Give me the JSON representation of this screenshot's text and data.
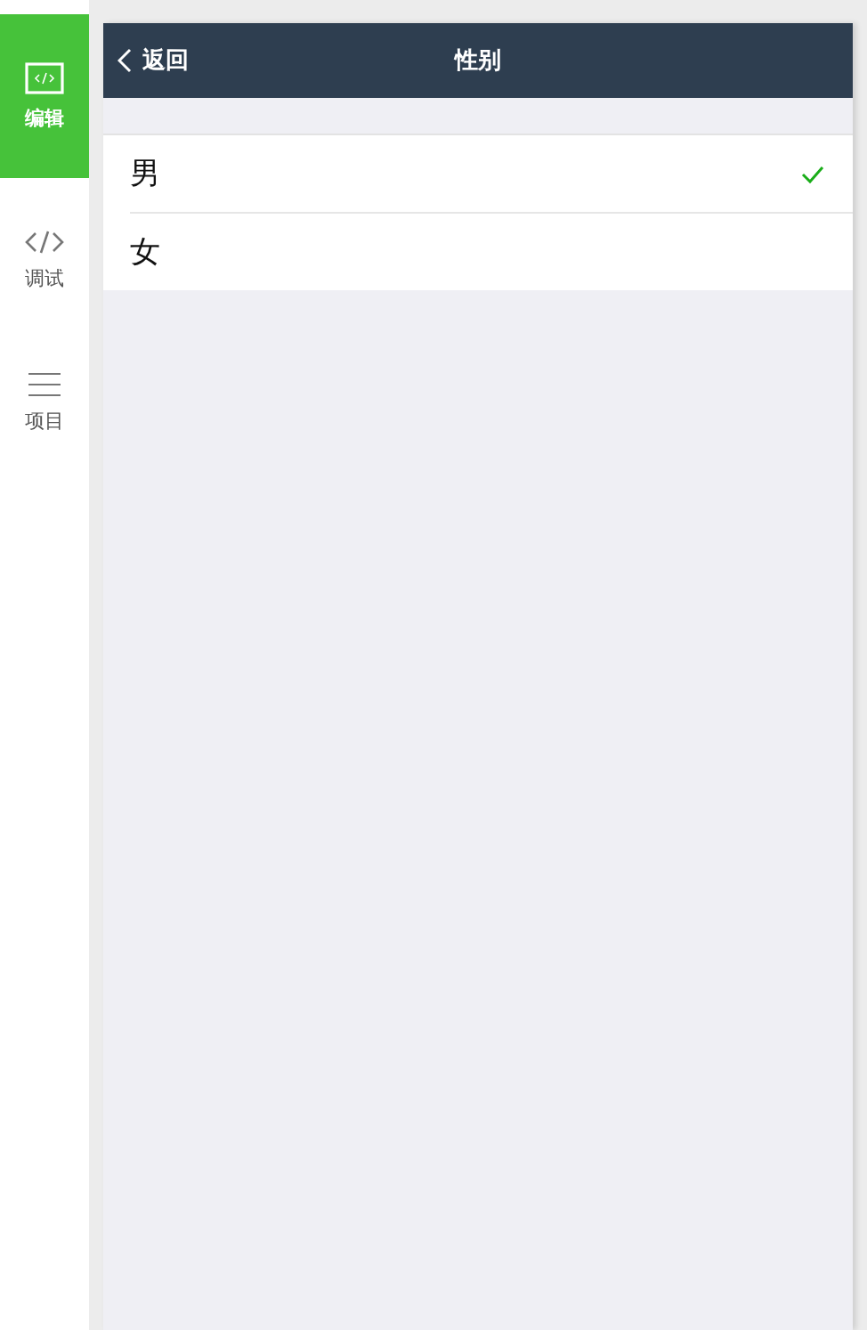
{
  "sidebar": {
    "items": [
      {
        "label": "编辑",
        "kind": "code",
        "selected": true
      },
      {
        "label": "调试",
        "kind": "code",
        "selected": false
      },
      {
        "label": "项目",
        "kind": "menu",
        "selected": false
      }
    ]
  },
  "navbar": {
    "back": "返回",
    "title": "性别"
  },
  "options": [
    {
      "label": "男",
      "selected": true
    },
    {
      "label": "女",
      "selected": false
    }
  ]
}
